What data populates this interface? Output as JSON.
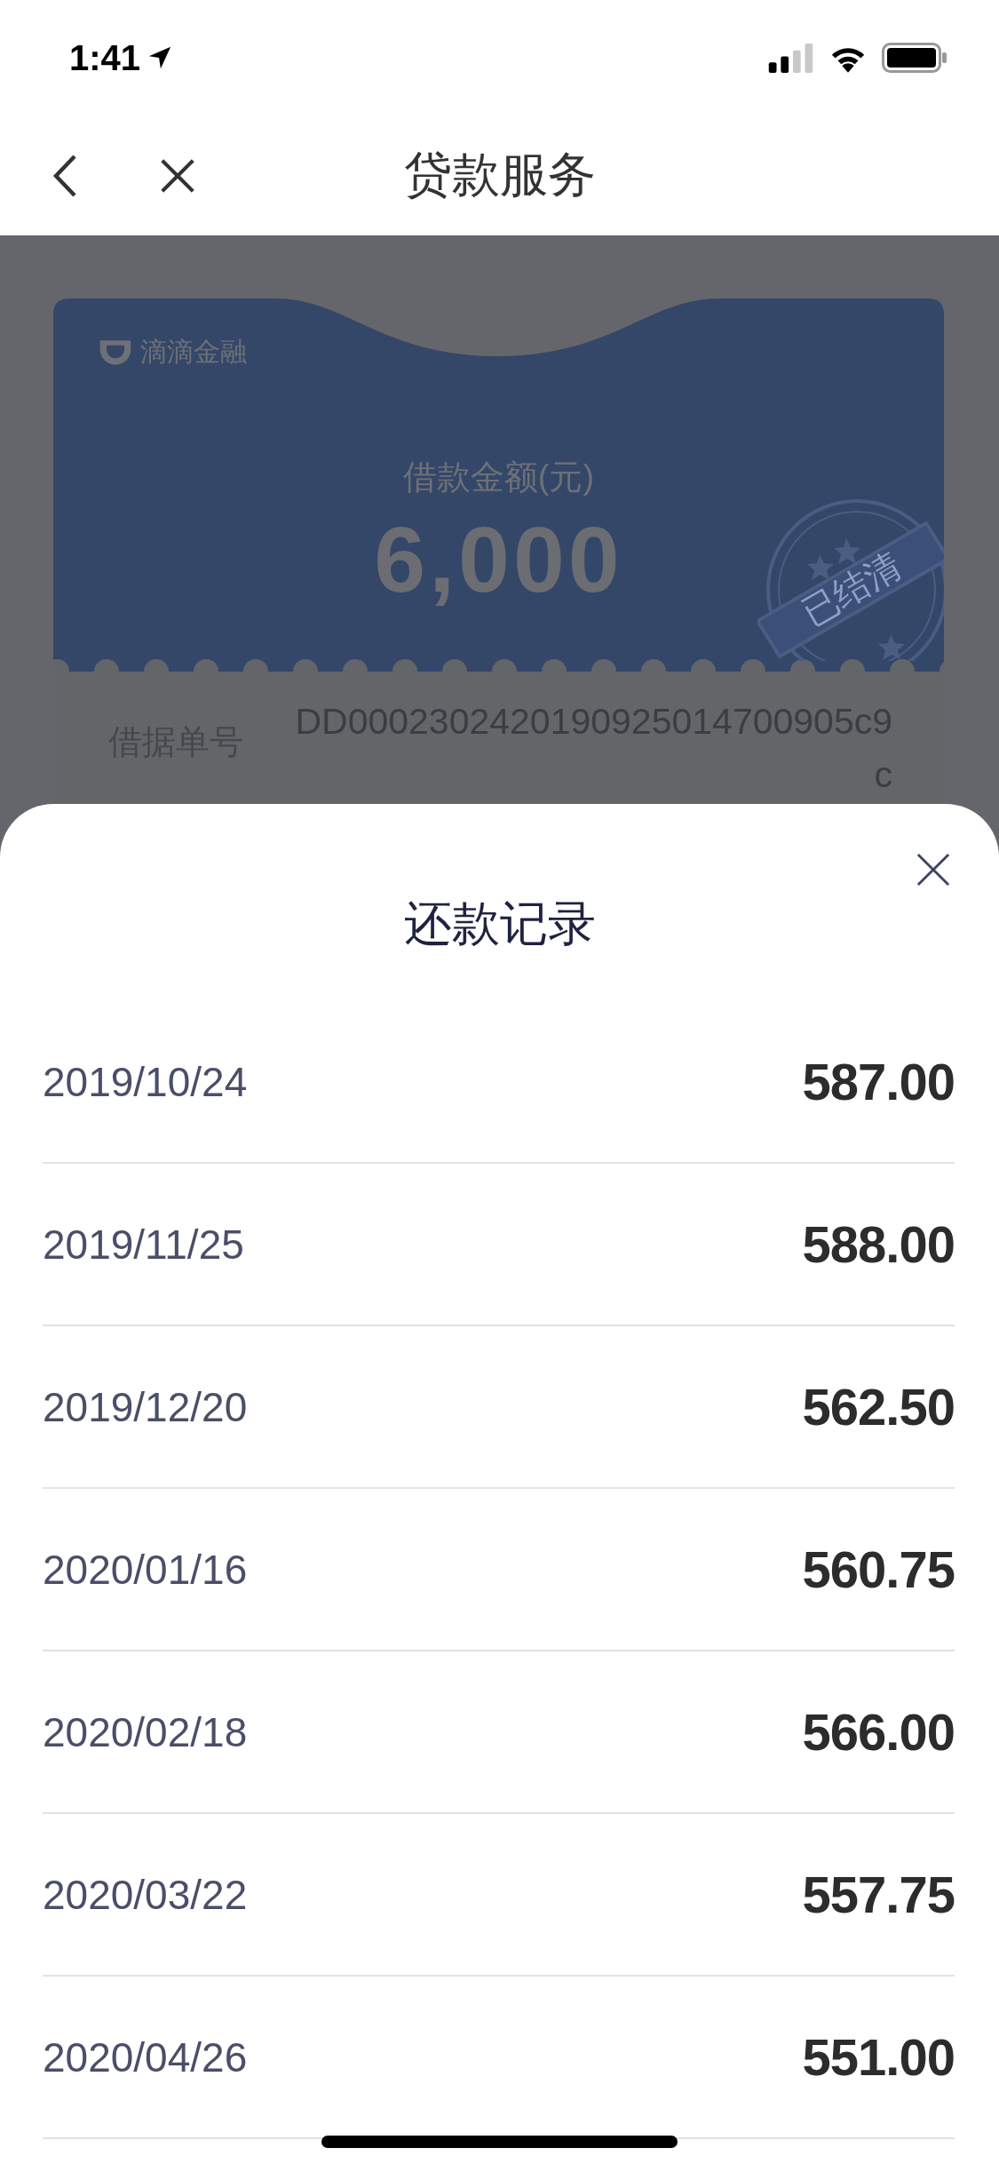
{
  "status_bar": {
    "time": "1:41"
  },
  "nav": {
    "title": "贷款服务"
  },
  "card": {
    "brand": "滴滴金融",
    "amount_label": "借款金额(元)",
    "amount": "6,000",
    "stamp": "已结清",
    "fields": [
      {
        "label": "借据单号",
        "value": "DD0002302420190925014700905c9c"
      }
    ]
  },
  "sheet": {
    "title": "还款记录",
    "records": [
      {
        "date": "2019/10/24",
        "amount": "587.00"
      },
      {
        "date": "2019/11/25",
        "amount": "588.00"
      },
      {
        "date": "2019/12/20",
        "amount": "562.50"
      },
      {
        "date": "2020/01/16",
        "amount": "560.75"
      },
      {
        "date": "2020/02/18",
        "amount": "566.00"
      },
      {
        "date": "2020/03/22",
        "amount": "557.75"
      },
      {
        "date": "2020/04/26",
        "amount": "551.00"
      }
    ]
  }
}
